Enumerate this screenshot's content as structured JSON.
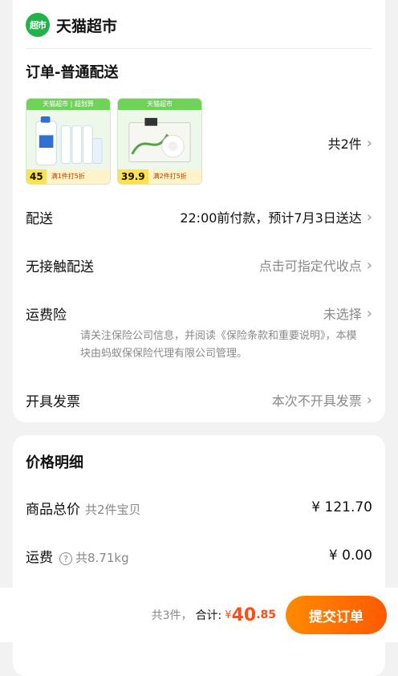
{
  "store": {
    "logo_text": "超市",
    "name": "天猫超市"
  },
  "order": {
    "type_label": "订单-普通配送",
    "products": [
      {
        "banner": "天猫超市 | 超划算",
        "price": "45",
        "promo": "满1件打5折"
      },
      {
        "banner": "天猫超市",
        "price": "39.9",
        "promo": "满2件打5折"
      }
    ],
    "count_text": "共2件",
    "rows": {
      "delivery": {
        "label": "配送",
        "value": "22:00前付款，预计7月3日送达"
      },
      "contactless": {
        "label": "无接触配送",
        "value": "点击可指定代收点"
      },
      "insurance": {
        "label": "运费险",
        "value": "未选择",
        "note": "请关注保险公司信息，并阅读《保险条款和重要说明》，本模块由蚂蚁保保险代理有限公司管理。"
      },
      "invoice": {
        "label": "开具发票",
        "value": "本次不开具发票"
      }
    }
  },
  "price_detail": {
    "title": "价格明细",
    "goods_total": {
      "label": "商品总价",
      "sub": "共2件宝贝",
      "value": "¥ 121.70"
    },
    "shipping": {
      "label": "运费",
      "help": "?",
      "sub": "共8.71kg",
      "value": "¥ 0.00"
    }
  },
  "bottom": {
    "count": "共3件，",
    "total_label": "合计:",
    "currency": "¥",
    "total_int": "40",
    "total_dec": ".85",
    "submit_label": "提交订单"
  },
  "icons": {
    "chevron": "chevron-right-icon",
    "help": "question-circle-icon"
  },
  "colors": {
    "brand_green": "#22b24c",
    "accent_orange": "#ff5a00",
    "price_red": "#ff4d1a"
  }
}
